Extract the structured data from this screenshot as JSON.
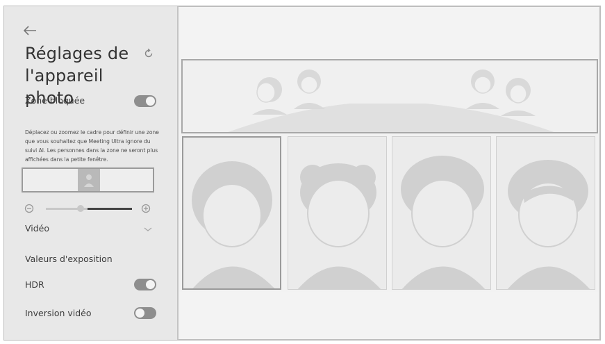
{
  "sidebar": {
    "title": "Réglages de l'appareil photo",
    "blocked_zone": {
      "label": "Zone bloquée",
      "enabled": true
    },
    "description": "Déplacez ou zoomez le cadre pour définir une zone que vous souhaitez que Meeting Ultra ignore du suivi AI. Les personnes dans la zone ne seront plus affichées dans la petite fenêtre.",
    "video_label": "Vidéo",
    "exposure_label": "Valeurs d'exposition",
    "hdr": {
      "label": "HDR",
      "enabled": true
    },
    "inversion": {
      "label": "Inversion vidéo",
      "enabled": false
    },
    "zoom_level": 0.4
  },
  "icons": {
    "back": "arrow-left-icon",
    "reset": "reset-icon",
    "zoom_out": "zoom-out-icon",
    "zoom_in": "zoom-in-icon",
    "dropdown": "chevron-down-icon"
  },
  "colors": {
    "sidebar_bg": "#e8e8e8",
    "toggle_on": "#8e8e8e",
    "figure": "#c9c9c9"
  }
}
